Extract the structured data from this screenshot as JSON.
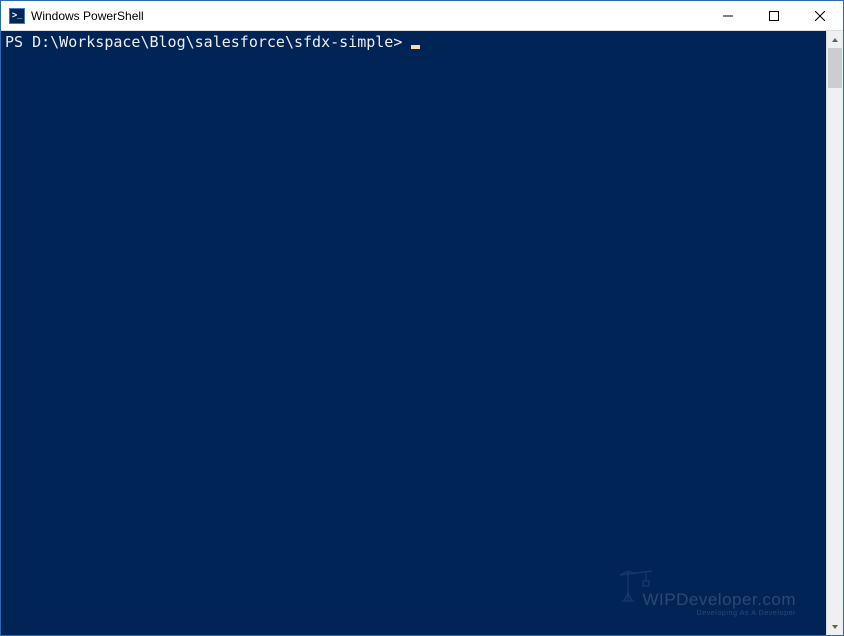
{
  "window": {
    "title": "Windows PowerShell"
  },
  "terminal": {
    "prompt": "PS D:\\Workspace\\Blog\\salesforce\\sfdx-simple> ",
    "background_color": "#012456",
    "text_color": "#eeedf0",
    "cursor_color": "#fedba9"
  },
  "watermark": {
    "main": "WIPDeveloper.com",
    "sub": "Developing As A Developer"
  }
}
